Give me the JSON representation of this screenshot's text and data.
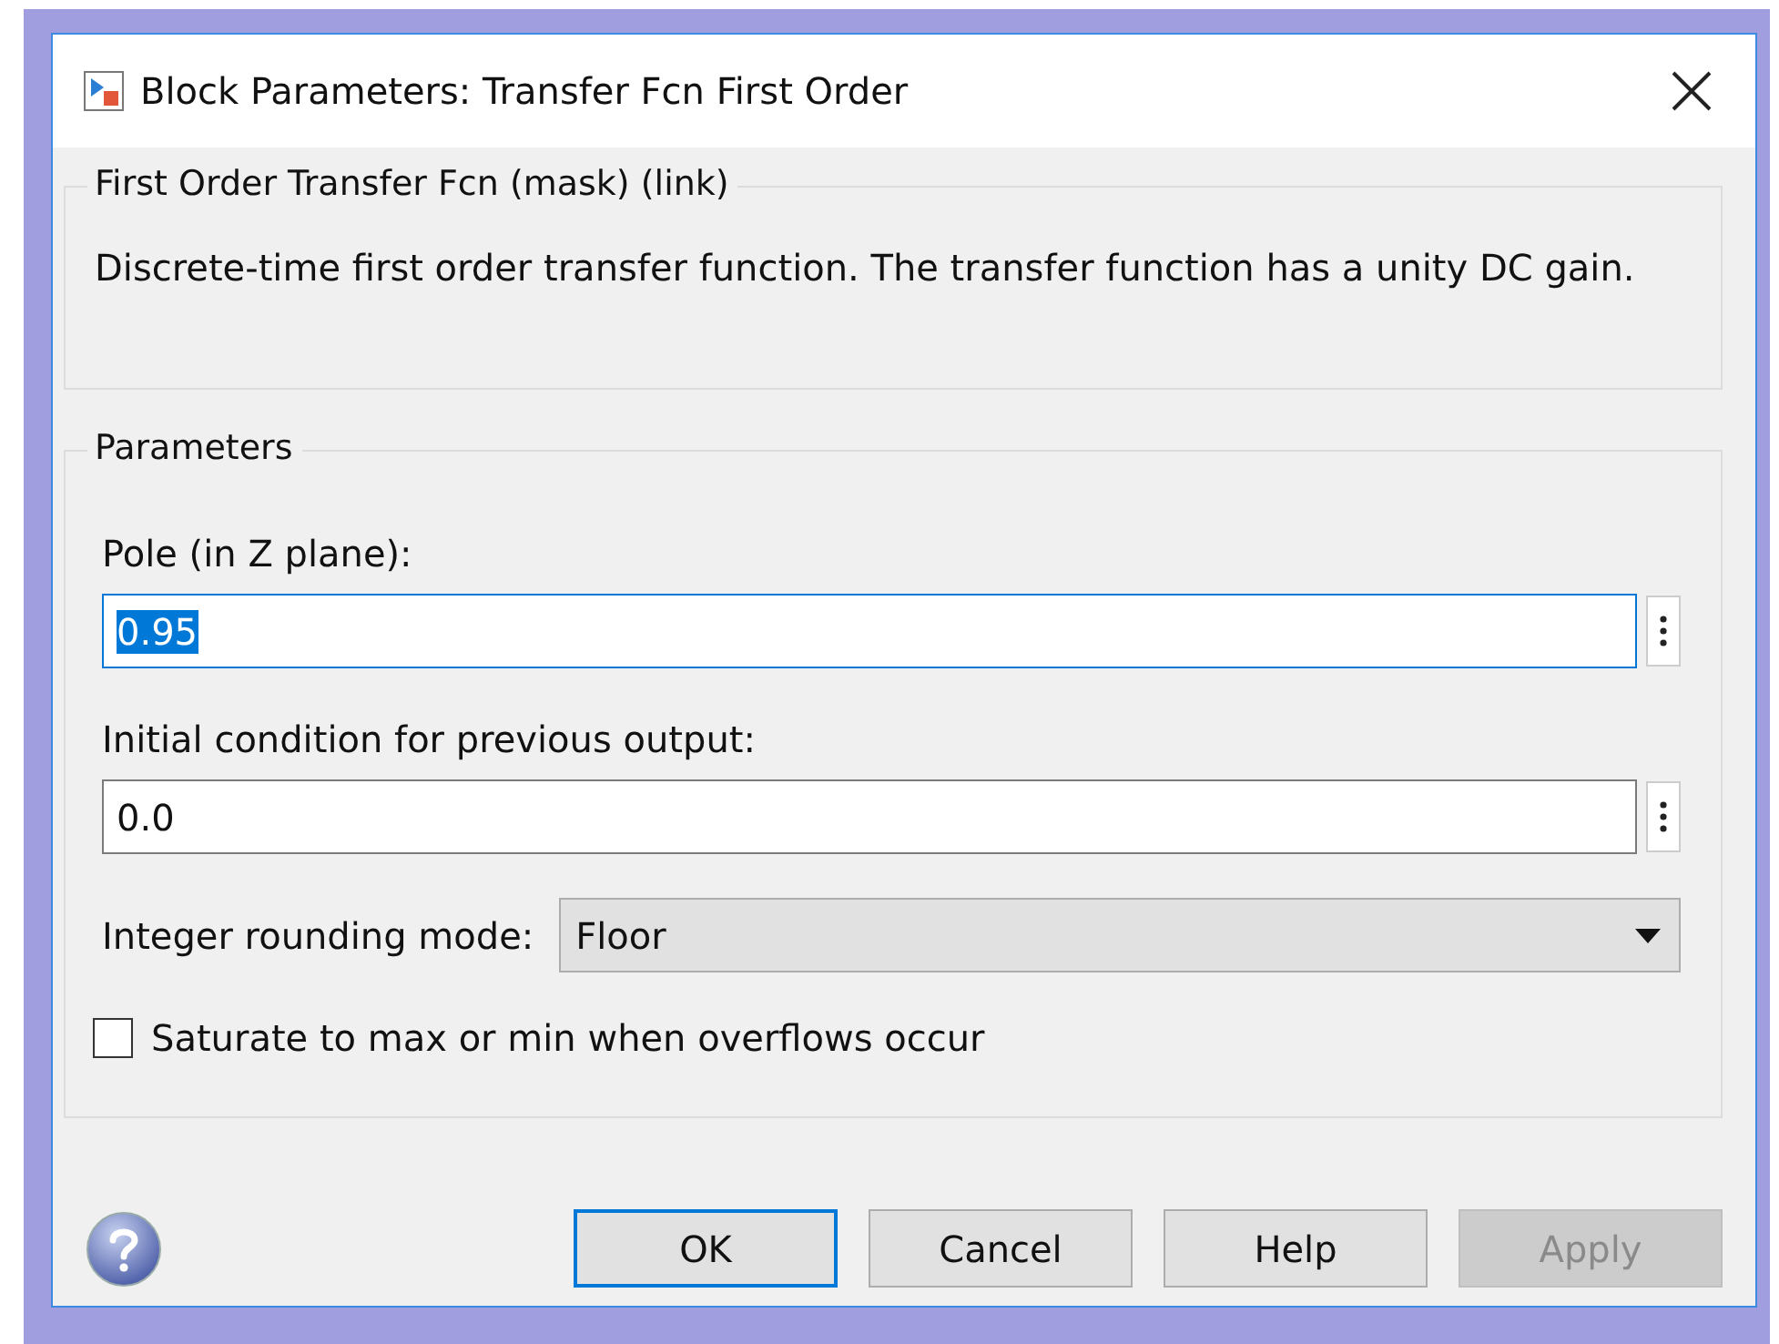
{
  "window": {
    "title": "Block Parameters: Transfer Fcn First Order"
  },
  "description_group": {
    "legend": "First Order Transfer Fcn (mask) (link)",
    "text": "Discrete-time first order transfer function.  The transfer function has a unity DC gain."
  },
  "parameters_group": {
    "legend": "Parameters",
    "fields": [
      {
        "label": "Pole (in Z plane):",
        "value": "0.95",
        "text_selected": true
      },
      {
        "label": "Initial condition for previous output:",
        "value": "0.0",
        "text_selected": false
      }
    ],
    "rounding": {
      "label": "Integer rounding mode:",
      "value": "Floor"
    },
    "saturate": {
      "label": "Saturate to max or min when overflows occur",
      "checked": false
    }
  },
  "buttons": [
    {
      "label": "OK",
      "default": true,
      "disabled": false
    },
    {
      "label": "Cancel",
      "default": false,
      "disabled": false
    },
    {
      "label": "Help",
      "default": false,
      "disabled": false
    },
    {
      "label": "Apply",
      "default": false,
      "disabled": true
    }
  ]
}
